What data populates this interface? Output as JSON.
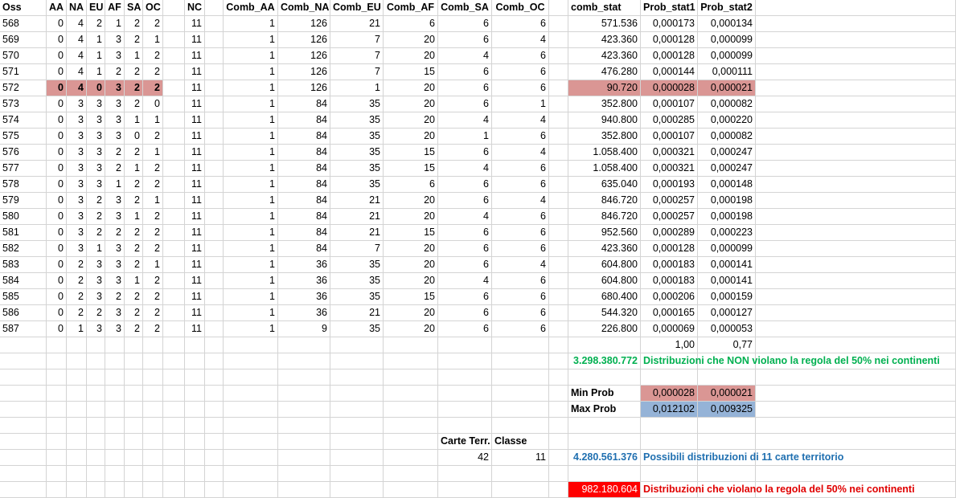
{
  "headers": [
    "Oss",
    "AA",
    "NA",
    "EU",
    "AF",
    "SA",
    "OC",
    "",
    "NC",
    "",
    "Comb_AA",
    "Comb_NA",
    "Comb_EU",
    "Comb_AF",
    "Comb_SA",
    "Comb_OC",
    "",
    "comb_stat",
    "Prob_stat1",
    "Prob_stat2"
  ],
  "rows": [
    {
      "oss": "568",
      "AA": "0",
      "NA": "4",
      "EU": "2",
      "AF": "1",
      "SA": "2",
      "OC": "2",
      "NC": "11",
      "Comb_AA": "1",
      "Comb_NA": "126",
      "Comb_EU": "21",
      "Comb_AF": "6",
      "Comb_SA": "6",
      "Comb_OC": "6",
      "comb_stat": "571.536",
      "p1": "0,000173",
      "p2": "0,000134"
    },
    {
      "oss": "569",
      "AA": "0",
      "NA": "4",
      "EU": "1",
      "AF": "3",
      "SA": "2",
      "OC": "1",
      "NC": "11",
      "Comb_AA": "1",
      "Comb_NA": "126",
      "Comb_EU": "7",
      "Comb_AF": "20",
      "Comb_SA": "6",
      "Comb_OC": "4",
      "comb_stat": "423.360",
      "p1": "0,000128",
      "p2": "0,000099"
    },
    {
      "oss": "570",
      "AA": "0",
      "NA": "4",
      "EU": "1",
      "AF": "3",
      "SA": "1",
      "OC": "2",
      "NC": "11",
      "Comb_AA": "1",
      "Comb_NA": "126",
      "Comb_EU": "7",
      "Comb_AF": "20",
      "Comb_SA": "4",
      "Comb_OC": "6",
      "comb_stat": "423.360",
      "p1": "0,000128",
      "p2": "0,000099"
    },
    {
      "oss": "571",
      "AA": "0",
      "NA": "4",
      "EU": "1",
      "AF": "2",
      "SA": "2",
      "OC": "2",
      "NC": "11",
      "Comb_AA": "1",
      "Comb_NA": "126",
      "Comb_EU": "7",
      "Comb_AF": "15",
      "Comb_SA": "6",
      "Comb_OC": "6",
      "comb_stat": "476.280",
      "p1": "0,000144",
      "p2": "0,000111"
    },
    {
      "oss": "572",
      "AA": "0",
      "NA": "4",
      "EU": "0",
      "AF": "3",
      "SA": "2",
      "OC": "2",
      "NC": "11",
      "Comb_AA": "1",
      "Comb_NA": "126",
      "Comb_EU": "1",
      "Comb_AF": "20",
      "Comb_SA": "6",
      "Comb_OC": "6",
      "comb_stat": "90.720",
      "p1": "0,000028",
      "p2": "0,000021",
      "highlight": true
    },
    {
      "oss": "573",
      "AA": "0",
      "NA": "3",
      "EU": "3",
      "AF": "3",
      "SA": "2",
      "OC": "0",
      "NC": "11",
      "Comb_AA": "1",
      "Comb_NA": "84",
      "Comb_EU": "35",
      "Comb_AF": "20",
      "Comb_SA": "6",
      "Comb_OC": "1",
      "comb_stat": "352.800",
      "p1": "0,000107",
      "p2": "0,000082"
    },
    {
      "oss": "574",
      "AA": "0",
      "NA": "3",
      "EU": "3",
      "AF": "3",
      "SA": "1",
      "OC": "1",
      "NC": "11",
      "Comb_AA": "1",
      "Comb_NA": "84",
      "Comb_EU": "35",
      "Comb_AF": "20",
      "Comb_SA": "4",
      "Comb_OC": "4",
      "comb_stat": "940.800",
      "p1": "0,000285",
      "p2": "0,000220"
    },
    {
      "oss": "575",
      "AA": "0",
      "NA": "3",
      "EU": "3",
      "AF": "3",
      "SA": "0",
      "OC": "2",
      "NC": "11",
      "Comb_AA": "1",
      "Comb_NA": "84",
      "Comb_EU": "35",
      "Comb_AF": "20",
      "Comb_SA": "1",
      "Comb_OC": "6",
      "comb_stat": "352.800",
      "p1": "0,000107",
      "p2": "0,000082"
    },
    {
      "oss": "576",
      "AA": "0",
      "NA": "3",
      "EU": "3",
      "AF": "2",
      "SA": "2",
      "OC": "1",
      "NC": "11",
      "Comb_AA": "1",
      "Comb_NA": "84",
      "Comb_EU": "35",
      "Comb_AF": "15",
      "Comb_SA": "6",
      "Comb_OC": "4",
      "comb_stat": "1.058.400",
      "p1": "0,000321",
      "p2": "0,000247"
    },
    {
      "oss": "577",
      "AA": "0",
      "NA": "3",
      "EU": "3",
      "AF": "2",
      "SA": "1",
      "OC": "2",
      "NC": "11",
      "Comb_AA": "1",
      "Comb_NA": "84",
      "Comb_EU": "35",
      "Comb_AF": "15",
      "Comb_SA": "4",
      "Comb_OC": "6",
      "comb_stat": "1.058.400",
      "p1": "0,000321",
      "p2": "0,000247"
    },
    {
      "oss": "578",
      "AA": "0",
      "NA": "3",
      "EU": "3",
      "AF": "1",
      "SA": "2",
      "OC": "2",
      "NC": "11",
      "Comb_AA": "1",
      "Comb_NA": "84",
      "Comb_EU": "35",
      "Comb_AF": "6",
      "Comb_SA": "6",
      "Comb_OC": "6",
      "comb_stat": "635.040",
      "p1": "0,000193",
      "p2": "0,000148"
    },
    {
      "oss": "579",
      "AA": "0",
      "NA": "3",
      "EU": "2",
      "AF": "3",
      "SA": "2",
      "OC": "1",
      "NC": "11",
      "Comb_AA": "1",
      "Comb_NA": "84",
      "Comb_EU": "21",
      "Comb_AF": "20",
      "Comb_SA": "6",
      "Comb_OC": "4",
      "comb_stat": "846.720",
      "p1": "0,000257",
      "p2": "0,000198"
    },
    {
      "oss": "580",
      "AA": "0",
      "NA": "3",
      "EU": "2",
      "AF": "3",
      "SA": "1",
      "OC": "2",
      "NC": "11",
      "Comb_AA": "1",
      "Comb_NA": "84",
      "Comb_EU": "21",
      "Comb_AF": "20",
      "Comb_SA": "4",
      "Comb_OC": "6",
      "comb_stat": "846.720",
      "p1": "0,000257",
      "p2": "0,000198"
    },
    {
      "oss": "581",
      "AA": "0",
      "NA": "3",
      "EU": "2",
      "AF": "2",
      "SA": "2",
      "OC": "2",
      "NC": "11",
      "Comb_AA": "1",
      "Comb_NA": "84",
      "Comb_EU": "21",
      "Comb_AF": "15",
      "Comb_SA": "6",
      "Comb_OC": "6",
      "comb_stat": "952.560",
      "p1": "0,000289",
      "p2": "0,000223"
    },
    {
      "oss": "582",
      "AA": "0",
      "NA": "3",
      "EU": "1",
      "AF": "3",
      "SA": "2",
      "OC": "2",
      "NC": "11",
      "Comb_AA": "1",
      "Comb_NA": "84",
      "Comb_EU": "7",
      "Comb_AF": "20",
      "Comb_SA": "6",
      "Comb_OC": "6",
      "comb_stat": "423.360",
      "p1": "0,000128",
      "p2": "0,000099"
    },
    {
      "oss": "583",
      "AA": "0",
      "NA": "2",
      "EU": "3",
      "AF": "3",
      "SA": "2",
      "OC": "1",
      "NC": "11",
      "Comb_AA": "1",
      "Comb_NA": "36",
      "Comb_EU": "35",
      "Comb_AF": "20",
      "Comb_SA": "6",
      "Comb_OC": "4",
      "comb_stat": "604.800",
      "p1": "0,000183",
      "p2": "0,000141"
    },
    {
      "oss": "584",
      "AA": "0",
      "NA": "2",
      "EU": "3",
      "AF": "3",
      "SA": "1",
      "OC": "2",
      "NC": "11",
      "Comb_AA": "1",
      "Comb_NA": "36",
      "Comb_EU": "35",
      "Comb_AF": "20",
      "Comb_SA": "4",
      "Comb_OC": "6",
      "comb_stat": "604.800",
      "p1": "0,000183",
      "p2": "0,000141"
    },
    {
      "oss": "585",
      "AA": "0",
      "NA": "2",
      "EU": "3",
      "AF": "2",
      "SA": "2",
      "OC": "2",
      "NC": "11",
      "Comb_AA": "1",
      "Comb_NA": "36",
      "Comb_EU": "35",
      "Comb_AF": "15",
      "Comb_SA": "6",
      "Comb_OC": "6",
      "comb_stat": "680.400",
      "p1": "0,000206",
      "p2": "0,000159"
    },
    {
      "oss": "586",
      "AA": "0",
      "NA": "2",
      "EU": "2",
      "AF": "3",
      "SA": "2",
      "OC": "2",
      "NC": "11",
      "Comb_AA": "1",
      "Comb_NA": "36",
      "Comb_EU": "21",
      "Comb_AF": "20",
      "Comb_SA": "6",
      "Comb_OC": "6",
      "comb_stat": "544.320",
      "p1": "0,000165",
      "p2": "0,000127"
    },
    {
      "oss": "587",
      "AA": "0",
      "NA": "1",
      "EU": "3",
      "AF": "3",
      "SA": "2",
      "OC": "2",
      "NC": "11",
      "Comb_AA": "1",
      "Comb_NA": "9",
      "Comb_EU": "35",
      "Comb_AF": "20",
      "Comb_SA": "6",
      "Comb_OC": "6",
      "comb_stat": "226.800",
      "p1": "0,000069",
      "p2": "0,000053"
    }
  ],
  "totals": {
    "p1": "1,00",
    "p2": "0,77"
  },
  "summary": {
    "non_violating_value": "3.298.380.772",
    "non_violating_text": "Distribuzioni che NON violano la regola del 50% nei continenti",
    "min_label": "Min Prob",
    "min_p1": "0,000028",
    "min_p2": "0,000021",
    "max_label": "Max Prob",
    "max_p1": "0,012102",
    "max_p2": "0,009325",
    "carte_label": "Carte Terr.",
    "classe_label": "Classe",
    "carte_value": "42",
    "classe_value": "11",
    "possible_value": "4.280.561.376",
    "possible_text": "Possibili distribuzioni di 11 carte territorio",
    "violating_value": "982.180.604",
    "violating_text": "Distribuzioni che violano la regola del 50% nei continenti"
  },
  "colors": {
    "highlight": "#da9694",
    "max_fill": "#95b3d7",
    "red_fill": "#ff0000",
    "green_text": "#00b050",
    "blue_text": "#1f6fb0",
    "red_text": "#e00000"
  }
}
